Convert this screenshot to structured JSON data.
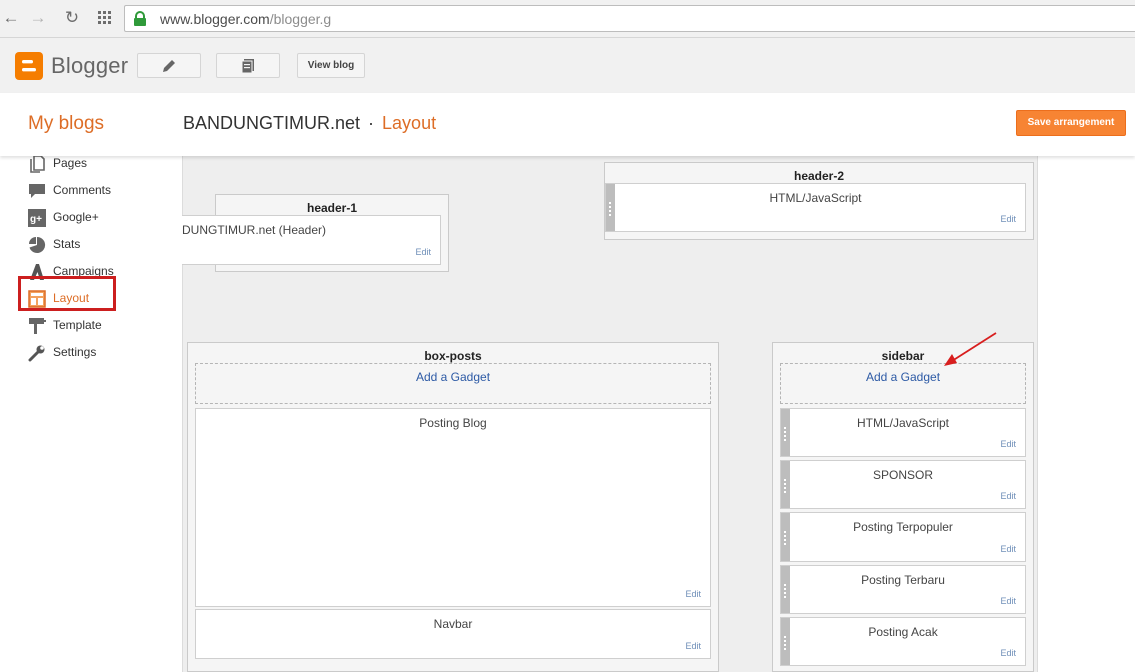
{
  "browser": {
    "url_domain": "www.blogger.com",
    "url_path": "/blogger.g"
  },
  "blogger_bar": {
    "logo_text": "Blogger",
    "view_blog_label": "View blog"
  },
  "header": {
    "my_blogs": "My blogs",
    "blog_name": "BANDUNGTIMUR.net",
    "separator": "·",
    "section": "Layout",
    "save_label": "Save arrangement"
  },
  "nav": {
    "items": [
      {
        "label": "Pages",
        "icon": "pages-icon"
      },
      {
        "label": "Comments",
        "icon": "comments-icon"
      },
      {
        "label": "Google+",
        "icon": "google-plus-icon"
      },
      {
        "label": "Stats",
        "icon": "stats-icon"
      },
      {
        "label": "Campaigns",
        "icon": "campaigns-icon"
      },
      {
        "label": "Layout",
        "icon": "layout-icon"
      },
      {
        "label": "Template",
        "icon": "template-icon"
      },
      {
        "label": "Settings",
        "icon": "settings-icon"
      }
    ],
    "active": "Layout"
  },
  "layout": {
    "header1": {
      "title": "header-1",
      "gadget": "DUNGTIMUR.net (Header)",
      "edit": "Edit"
    },
    "header2": {
      "title": "header-2",
      "gadget": "HTML/JavaScript",
      "edit": "Edit"
    },
    "box_posts": {
      "title": "box-posts",
      "add_gadget": "Add a Gadget",
      "gadgets": [
        {
          "name": "Posting Blog",
          "edit": "Edit"
        },
        {
          "name": "Navbar",
          "edit": "Edit"
        }
      ]
    },
    "sidebar": {
      "title": "sidebar",
      "add_gadget": "Add a Gadget",
      "gadgets": [
        {
          "name": "HTML/JavaScript",
          "edit": "Edit"
        },
        {
          "name": "SPONSOR",
          "edit": "Edit"
        },
        {
          "name": "Posting Terpopuler",
          "edit": "Edit"
        },
        {
          "name": "Posting Terbaru",
          "edit": "Edit"
        },
        {
          "name": "Posting Acak",
          "edit": "Edit"
        }
      ]
    }
  },
  "colors": {
    "accent": "#dd6d26",
    "save_button": "#f78433",
    "highlight_box": "#cc1f1f",
    "arrow": "#d81e1e",
    "link": "#2d5aa5"
  }
}
